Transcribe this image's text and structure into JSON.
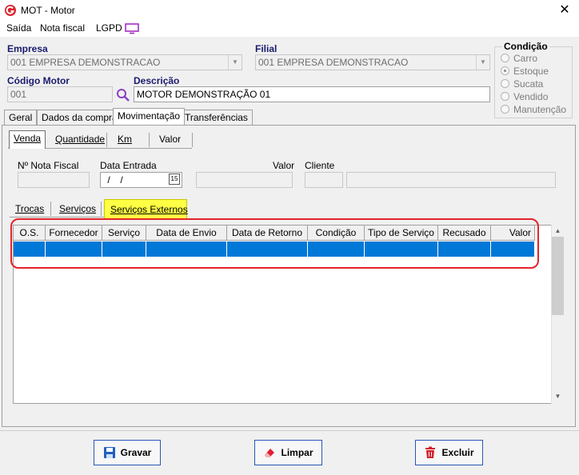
{
  "window": {
    "title": "MOT - Motor",
    "close_glyph": "✕"
  },
  "menu": {
    "items": [
      "Saída",
      "Nota fiscal",
      "LGPD"
    ]
  },
  "form": {
    "empresa_label": "Empresa",
    "empresa_value": "001 EMPRESA DEMONSTRACAO",
    "filial_label": "Filial",
    "filial_value": "001 EMPRESA DEMONSTRACAO",
    "codigo_label": "Código Motor",
    "codigo_value": "001",
    "descricao_label": "Descrição",
    "descricao_value": "MOTOR DEMONSTRAÇÃO 01"
  },
  "condicao": {
    "title": "Condição",
    "options": [
      "Carro",
      "Estoque",
      "Sucata",
      "Vendido",
      "Manutenção"
    ],
    "selected": "Estoque"
  },
  "tabs": [
    "Geral",
    "Dados da compra",
    "Movimentação",
    "Transferências"
  ],
  "active_tab": "Movimentação",
  "subtabs": [
    "Venda",
    "Quantidade",
    "Km",
    "Valor"
  ],
  "venda": {
    "nota_label": "Nº Nota Fiscal",
    "data_label": "Data Entrada",
    "data_value": " /  / ",
    "calendar_value": "15",
    "valor_label": "Valor",
    "cliente_label": "Cliente"
  },
  "inner_tabs": [
    "Trocas",
    "Serviços",
    "Serviços Externos"
  ],
  "active_inner_tab": "Serviços Externos",
  "grid": {
    "columns": [
      "O.S.",
      "Fornecedor",
      "Serviço",
      "Data de Envio",
      "Data de Retorno",
      "Condição",
      "Tipo de Serviço",
      "Recusado",
      "Valor"
    ]
  },
  "buttons": {
    "gravar": "Gravar",
    "limpar": "Limpar",
    "excluir": "Excluir"
  },
  "colors": {
    "selection": "#0078d7",
    "highlight": "#e3242b",
    "tab_highlight": "#ffff44",
    "label": "#1a1a6e"
  }
}
